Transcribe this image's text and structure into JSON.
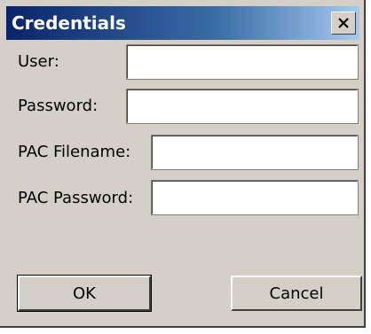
{
  "window": {
    "title": "Credentials",
    "close_icon": "close-icon",
    "titlebar_colors": [
      "#0a246a",
      "#a6caf0"
    ]
  },
  "form": {
    "user_label": "User:",
    "user_value": "",
    "password_label": "Password:",
    "password_value": "",
    "pac_filename_label": "PAC Filename:",
    "pac_filename_value": "",
    "pac_password_label": "PAC Password:",
    "pac_password_value": ""
  },
  "buttons": {
    "ok_label": "OK",
    "cancel_label": "Cancel"
  }
}
